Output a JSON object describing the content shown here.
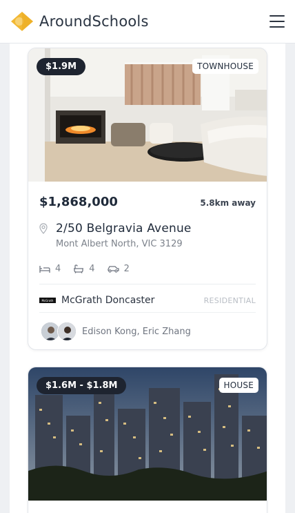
{
  "header": {
    "brand_name": "AroundSchools",
    "logo_icon": "map-pin-logo",
    "menu_icon": "hamburger-menu-icon",
    "accent_color": "#f2b833"
  },
  "listings": [
    {
      "price_badge": "$1.9M",
      "type_badge": "TOWNHOUSE",
      "price": "$1,868,000",
      "distance": "5.8km away",
      "street": "2/50 Belgravia Avenue",
      "suburb": "Mont Albert North, VIC 3129",
      "bedrooms": "4",
      "bathrooms": "4",
      "parking": "2",
      "agency_logo_text": "McGrath",
      "agency": "McGrath Doncaster",
      "category": "RESIDENTIAL",
      "agents": "Edison Kong, Eric Zhang",
      "image": "living-room-interior"
    },
    {
      "price_badge": "$1.6M - $1.8M",
      "type_badge": "HOUSE",
      "image": "city-skyline-dusk"
    }
  ]
}
